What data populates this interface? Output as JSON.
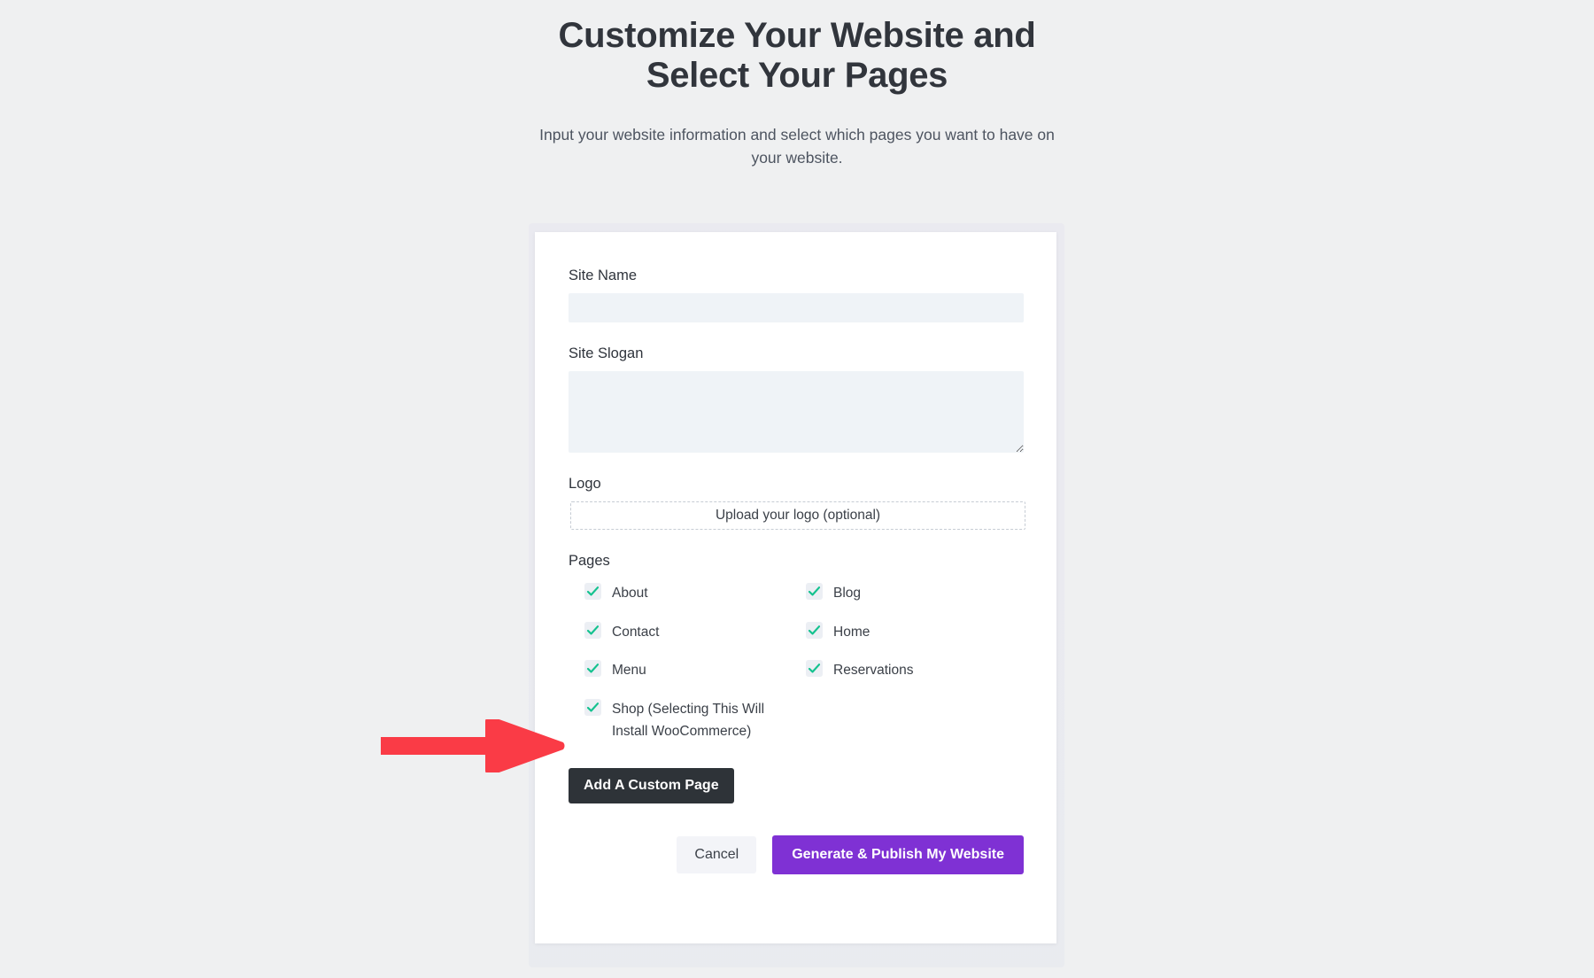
{
  "header": {
    "title": "Customize Your Website and Select Your Pages",
    "subtitle": "Input your website information and select which pages you want to have on your website."
  },
  "form": {
    "site_name": {
      "label": "Site Name",
      "value": "",
      "placeholder": ""
    },
    "site_slogan": {
      "label": "Site Slogan",
      "value": "",
      "placeholder": ""
    },
    "logo": {
      "label": "Logo",
      "upload_text": "Upload your logo (optional)"
    },
    "pages": {
      "label": "Pages",
      "items": [
        {
          "label": "About",
          "checked": true,
          "column": "left"
        },
        {
          "label": "Blog",
          "checked": true,
          "column": "right"
        },
        {
          "label": "Contact",
          "checked": true,
          "column": "left"
        },
        {
          "label": "Home",
          "checked": true,
          "column": "right"
        },
        {
          "label": "Menu",
          "checked": true,
          "column": "left"
        },
        {
          "label": "Reservations",
          "checked": true,
          "column": "right"
        },
        {
          "label": "Shop (Selecting This Will Install WooCommerce)",
          "checked": true,
          "column": "left"
        }
      ]
    },
    "add_custom_page_label": "Add A Custom Page",
    "cancel_label": "Cancel",
    "submit_label": "Generate & Publish My Website"
  },
  "annotation": {
    "arrow_icon": "right-arrow-icon",
    "points_to": "Shop (Selecting This Will Install WooCommerce)"
  },
  "colors": {
    "page_background": "#eff0f1",
    "card_background": "#ffffff",
    "input_background": "#eff3f7",
    "checkbox_background": "#eceff4",
    "checkmark": "#14c28f",
    "primary_button": "#7f31d4",
    "dark_button": "#2e3338",
    "cancel_button": "#f3f4f8",
    "annotation_arrow": "#fa3b46",
    "title_text": "#31353c",
    "body_text": "#3b4048"
  }
}
